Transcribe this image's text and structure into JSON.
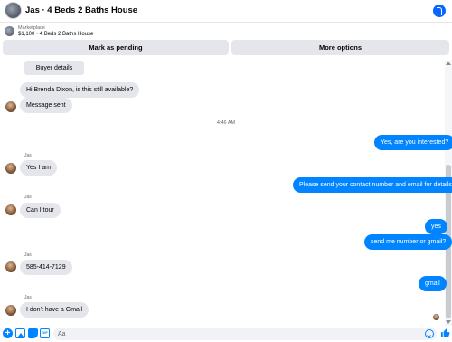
{
  "header": {
    "title": "Jas · 4 Beds 2 Baths House"
  },
  "listing": {
    "market_label": "Marketplace",
    "description": "$1,100 · 4 Beds 2 Baths House"
  },
  "actions": {
    "mark_pending": "Mark as pending",
    "more_options": "More options"
  },
  "buyer_details": "Buyer details",
  "messages": {
    "m1": "Hi Brenda Dixon, is this still available?",
    "m2": "Message sent",
    "timestamp": "4:46 AM",
    "m3": "Yes, are you interested?",
    "m4_sender": "Jas",
    "m4": "Yes I am",
    "m5": "Please send your contact number and email for details",
    "m6_sender": "Jas",
    "m6": "Can I tour",
    "m7": "yes",
    "m8": "send me number or gmail?",
    "m9_sender": "Jas",
    "m9": "585-414-7129",
    "m10": "gmail",
    "m11_sender": "Jas",
    "m11": "I don't have a Gmail"
  },
  "composer": {
    "placeholder": "Aa"
  },
  "colors": {
    "outgoing_bubble": "#0084ff",
    "incoming_bubble": "#e4e6eb",
    "accent": "#0866ff"
  }
}
